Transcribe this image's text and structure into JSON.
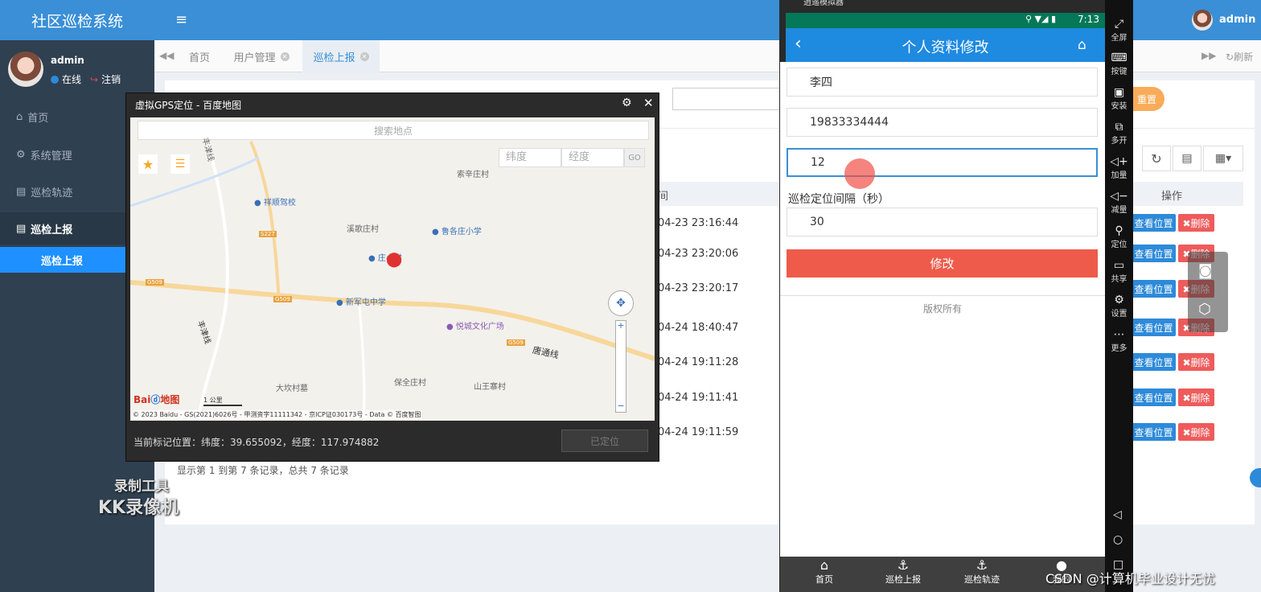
{
  "app": {
    "title": "社区巡检系统",
    "user": "admin"
  },
  "sidebar": {
    "user": "admin",
    "online": "在线",
    "logout": "注销",
    "items": [
      {
        "icon": "home-icon",
        "label": "首页"
      },
      {
        "icon": "gear-icon",
        "label": "系统管理"
      },
      {
        "icon": "book-icon",
        "label": "巡检轨迹"
      },
      {
        "icon": "book-icon",
        "label": "巡检上报"
      }
    ],
    "sub_active": "巡检上报"
  },
  "tabs": [
    {
      "label": "首页"
    },
    {
      "label": "用户管理"
    },
    {
      "label": "巡检上报"
    }
  ],
  "toolbar": {
    "reset": "重置",
    "refresh": "刷新"
  },
  "table": {
    "op_header": "操作",
    "time_header_fragment": "间",
    "rows": [
      {
        "time": "04-23 23:16:44"
      },
      {
        "time": "04-23 23:20:06"
      },
      {
        "time": "04-23 23:20:17"
      },
      {
        "time": "04-24 18:40:47"
      },
      {
        "time": "04-24 19:11:28"
      },
      {
        "time": "04-24 19:11:41"
      },
      {
        "time": "04-24 19:11:59"
      }
    ],
    "view_label": "查看位置",
    "delete_label": "✖删除",
    "summary": "显示第 1 到第 7 条记录，总共 7 条记录"
  },
  "gps_dialog": {
    "title": "虚拟GPS定位 - 百度地图",
    "search_placeholder": "搜索地点",
    "lat_placeholder": "纬度",
    "lng_placeholder": "经度",
    "go": "GO",
    "status": "当前标记位置：纬度：39.655092，经度：117.974882",
    "button": "已定位",
    "map_labels": [
      "丰津线",
      "祥顺驾校",
      "索辛庄村",
      "溪歌庄村",
      "鲁各庄小学",
      "庄小学",
      "新军屯中学",
      "悦城文化广场",
      "唐通线",
      "保全庄村",
      "山王寨村",
      "大坎村墓",
      "丰津线",
      "G509",
      "S227",
      "G509",
      "G509"
    ],
    "scale": "1 公里",
    "copyright": "© 2023 Baidu - GS(2021)6026号 - 甲测资字11111342 - 京ICP证030173号 - Data © 百度智图",
    "logo": "Bai 地图"
  },
  "emulator": {
    "title": "逍遥模拟器",
    "time": "7:13",
    "page_title": "个人资料修改",
    "fields": [
      {
        "value": "李四"
      },
      {
        "value": "19833334444"
      },
      {
        "value": "12"
      }
    ],
    "interval_label": "巡检定位间隔（秒）",
    "interval_value": "30",
    "submit": "修改",
    "copyright": "版权所有",
    "tabs": [
      "首页",
      "巡检上报",
      "巡检轨迹",
      "我的"
    ],
    "tools": [
      "全屏",
      "按键",
      "安装",
      "多开",
      "加量",
      "减量",
      "定位",
      "共享",
      "设置",
      "更多"
    ]
  },
  "watermark": {
    "line1": "录制工具",
    "line2": "KK录像机",
    "csdn": "CSDN @计算机毕业设计无忧"
  }
}
